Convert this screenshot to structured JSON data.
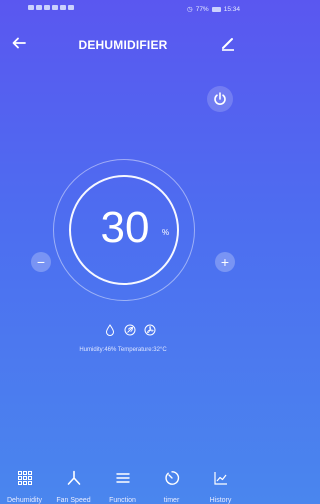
{
  "status_bar": {
    "right_text": "77%",
    "time": "15:34",
    "icons": [
      "sim-icon",
      "signal-icon",
      "wifi-icon",
      "notification-icons",
      "alarm-icon",
      "battery-icon"
    ]
  },
  "header": {
    "title": "DEHUMIDIFIER",
    "back_icon": "back-arrow-icon",
    "edit_icon": "pencil-icon"
  },
  "power": {
    "icon": "power-icon"
  },
  "dial": {
    "value": "30",
    "unit": "%"
  },
  "controls": {
    "minus": "−",
    "plus": "+"
  },
  "modes": [
    "drop-icon",
    "leaf-icon",
    "fan-icon"
  ],
  "readings": "Humidity:46%  Temperature:32°C",
  "tabs": [
    {
      "label": "Dehumidity",
      "icon": "grid-icon"
    },
    {
      "label": "Fan Speed",
      "icon": "fan-icon"
    },
    {
      "label": "Function",
      "icon": "menu-icon"
    },
    {
      "label": "timer",
      "icon": "timer-icon"
    },
    {
      "label": "History",
      "icon": "chart-icon"
    }
  ],
  "colors": {
    "background_top": "#5a57f0",
    "background_bottom": "#4a86ee",
    "foreground": "#ffffff"
  }
}
